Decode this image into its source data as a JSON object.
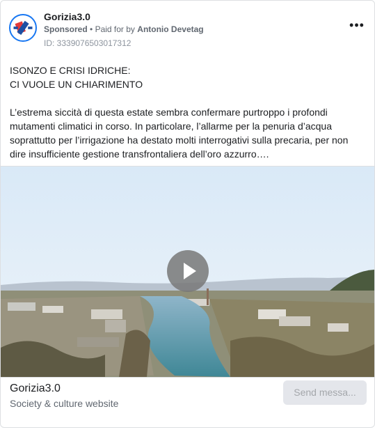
{
  "ad": {
    "page_name": "Gorizia3.0",
    "sponsored_label": "Sponsored",
    "paid_for_prefix": "Paid for by",
    "payer_name": "Antonio Devetag",
    "id_label": "ID: 3339076503017312",
    "more_icon": "more-horizontal-icon",
    "more_glyph": "•••"
  },
  "body": {
    "headline_line1": "ISONZO E CRISI IDRICHE:",
    "headline_line2": "CI VUOLE UN CHIARIMENTO",
    "paragraph": "L’estrema siccità di questa estate sembra confermare purtroppo i profondi mutamenti climatici in corso. In particolare, l’allarme per la penuria d’acqua soprattutto per l’irrigazione ha destato molti interrogativi sulla precaria, per non dire insufficiente gestione transfrontaliera dell’oro azzurro…."
  },
  "media": {
    "type": "video",
    "play_icon": "play-icon"
  },
  "footer": {
    "title": "Gorizia3.0",
    "subtitle": "Society & culture website",
    "cta_label": "Send messa..."
  },
  "colors": {
    "accent": "#1877f2",
    "cta_bg": "#e4e6eb",
    "cta_text": "#a4a7ab",
    "secondary_text": "#606770"
  }
}
